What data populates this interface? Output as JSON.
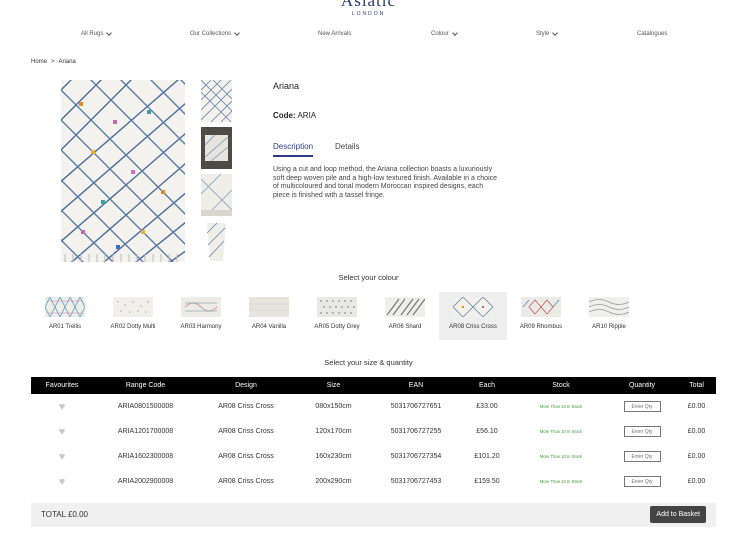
{
  "brand": {
    "name": "Asiatic",
    "sub": "LONDON"
  },
  "nav": [
    {
      "label": "All Rugs",
      "dropdown": true
    },
    {
      "label": "Our Collections",
      "dropdown": true
    },
    {
      "label": "New Arrivals",
      "dropdown": false
    },
    {
      "label": "Colour",
      "dropdown": true
    },
    {
      "label": "Style",
      "dropdown": true
    },
    {
      "label": "Catalogues",
      "dropdown": false
    }
  ],
  "breadcrumb": {
    "home": "Home",
    "separator": ">",
    "current": "Ariana"
  },
  "product": {
    "name": "Ariana",
    "code_label": "Code:",
    "code": "ARIA",
    "tabs": [
      "Description",
      "Details"
    ],
    "description": "Using a cut and loop method, the Ariana collection boasts a luxuriously soft deep woven pile and a high-low textured finish. Available in a choice of multicoloured and tonal modern Moroccan inspired designs, each piece is finished with a tassel fringe."
  },
  "colour_section": {
    "title": "Select your colour",
    "swatches": [
      {
        "label": "AR01 Trellis"
      },
      {
        "label": "AR02 Dotty Multi"
      },
      {
        "label": "AR03 Harmony"
      },
      {
        "label": "AR04 Vanilla"
      },
      {
        "label": "AR05 Dotty Grey"
      },
      {
        "label": "AR06 Shard"
      },
      {
        "label": "AR08 Criss Cross"
      },
      {
        "label": "AR09 Rhombus"
      },
      {
        "label": "AR10 Ripple"
      }
    ],
    "selected_index": 6
  },
  "size_section": {
    "title": "Select your size & quantity",
    "headers": [
      "Favourites",
      "Range Code",
      "Design",
      "Size",
      "EAN",
      "Each",
      "Stock",
      "Quantity",
      "Total"
    ],
    "qty_placeholder": "Enter Qty",
    "rows": [
      {
        "code": "ARIA0801500008",
        "design": "AR08 Criss Cross",
        "size": "080x150cm",
        "ean": "5031706727651",
        "each": "£33.00",
        "stock": "More Than 10 In Stock",
        "total": "£0.00"
      },
      {
        "code": "ARIA1201700008",
        "design": "AR08 Criss Cross",
        "size": "120x170cm",
        "ean": "5031706727255",
        "each": "£56.10",
        "stock": "More Than 10 In Stock",
        "total": "£0.00"
      },
      {
        "code": "ARIA1602300008",
        "design": "AR08 Criss Cross",
        "size": "160x230cm",
        "ean": "5031706727354",
        "each": "£101.20",
        "stock": "More Than 10 In Stock",
        "total": "£0.00"
      },
      {
        "code": "ARIA2002900008",
        "design": "AR08 Criss Cross",
        "size": "200x290cm",
        "ean": "5031706727453",
        "each": "£159.50",
        "stock": "More Than 10 In Stock",
        "total": "£0.00"
      }
    ]
  },
  "totals": {
    "label": "TOTAL £0.00",
    "basket_button": "Add to Basket"
  },
  "colors": {
    "accent": "#2a3a8b",
    "stock_green": "#3a9a3a",
    "table_header": "#000000"
  },
  "icons": {
    "favourite": "heart-icon",
    "dropdown": "chevron-down-icon"
  }
}
